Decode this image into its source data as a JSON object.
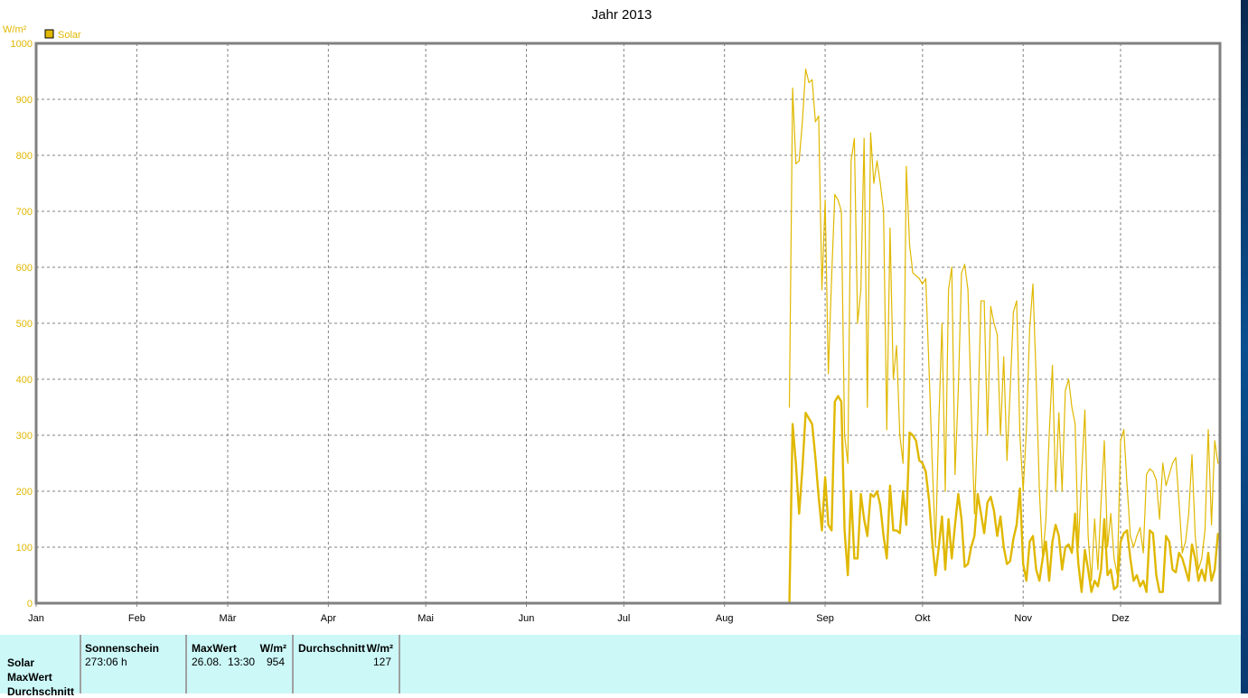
{
  "chart_data": {
    "type": "line",
    "title": "Jahr 2013",
    "ylabel": "W/m²",
    "ylim": [
      0,
      1000
    ],
    "yticks": [
      0,
      100,
      200,
      300,
      400,
      500,
      600,
      700,
      800,
      900,
      1000
    ],
    "xticks": [
      "Jan",
      "Feb",
      "Mär",
      "Apr",
      "Mai",
      "Jun",
      "Jul",
      "Aug",
      "Sep",
      "Okt",
      "Nov",
      "Dez"
    ],
    "xtick_days": [
      0,
      31,
      59,
      90,
      120,
      151,
      181,
      212,
      243,
      273,
      304,
      334
    ],
    "days_in_year": 365,
    "grid": true,
    "legend": [
      {
        "label": "Solar",
        "color": "#e0b800"
      }
    ],
    "legend_placement": "top-left",
    "series_start_day": 232,
    "series": [
      {
        "name": "Solar max",
        "color": "#e0b800",
        "values": [
          350,
          920,
          785,
          790,
          860,
          954,
          930,
          935,
          860,
          870,
          560,
          720,
          410,
          580,
          730,
          720,
          700,
          300,
          250,
          790,
          830,
          500,
          560,
          830,
          350,
          840,
          750,
          790,
          750,
          700,
          310,
          670,
          400,
          460,
          300,
          250,
          780,
          640,
          590,
          585,
          580,
          570,
          580,
          420,
          250,
          100,
          320,
          500,
          200,
          560,
          600,
          230,
          380,
          590,
          605,
          560,
          350,
          160,
          320,
          540,
          540,
          300,
          530,
          500,
          480,
          300,
          440,
          255,
          380,
          520,
          540,
          300,
          200,
          310,
          490,
          570,
          400,
          200,
          80,
          150,
          300,
          425,
          200,
          340,
          200,
          380,
          400,
          350,
          320,
          100,
          230,
          345,
          120,
          40,
          150,
          60,
          180,
          290,
          100,
          160,
          80,
          50,
          290,
          310,
          210,
          120,
          100,
          120,
          135,
          90,
          230,
          240,
          235,
          220,
          150,
          250,
          210,
          230,
          250,
          260,
          180,
          90,
          110,
          160,
          265,
          120,
          60,
          80,
          130,
          310,
          140,
          290,
          250
        ]
      },
      {
        "name": "Solar avg",
        "color": "#e0b800",
        "values": [
          0,
          320,
          250,
          160,
          240,
          340,
          330,
          320,
          260,
          190,
          130,
          225,
          140,
          130,
          360,
          370,
          360,
          130,
          50,
          200,
          80,
          80,
          195,
          150,
          120,
          195,
          190,
          200,
          175,
          120,
          80,
          210,
          130,
          130,
          125,
          200,
          140,
          305,
          300,
          290,
          255,
          250,
          235,
          185,
          110,
          50,
          100,
          155,
          60,
          150,
          80,
          140,
          195,
          150,
          65,
          70,
          100,
          120,
          195,
          160,
          125,
          180,
          190,
          165,
          120,
          155,
          100,
          70,
          75,
          115,
          140,
          205,
          70,
          40,
          110,
          120,
          60,
          40,
          80,
          110,
          40,
          110,
          140,
          120,
          60,
          100,
          105,
          90,
          160,
          70,
          20,
          95,
          60,
          20,
          40,
          30,
          60,
          150,
          50,
          60,
          25,
          30,
          110,
          125,
          130,
          80,
          40,
          50,
          30,
          40,
          20,
          130,
          125,
          50,
          20,
          20,
          120,
          110,
          60,
          55,
          90,
          80,
          60,
          40,
          105,
          80,
          40,
          60,
          40,
          90,
          40,
          60,
          125
        ]
      }
    ]
  },
  "stats": {
    "row_labels": [
      "Solar",
      "MaxWert",
      "Durchschnitt"
    ],
    "sonnenschein": {
      "header": "Sonnenschein",
      "value": "273:06 h"
    },
    "maxwert": {
      "header": "MaxWert",
      "unit": "W/m²",
      "date": "26.08.  13:30",
      "value": "954"
    },
    "durchschnitt": {
      "header": "Durchschnitt",
      "unit": "W/m²",
      "value": "127"
    }
  }
}
